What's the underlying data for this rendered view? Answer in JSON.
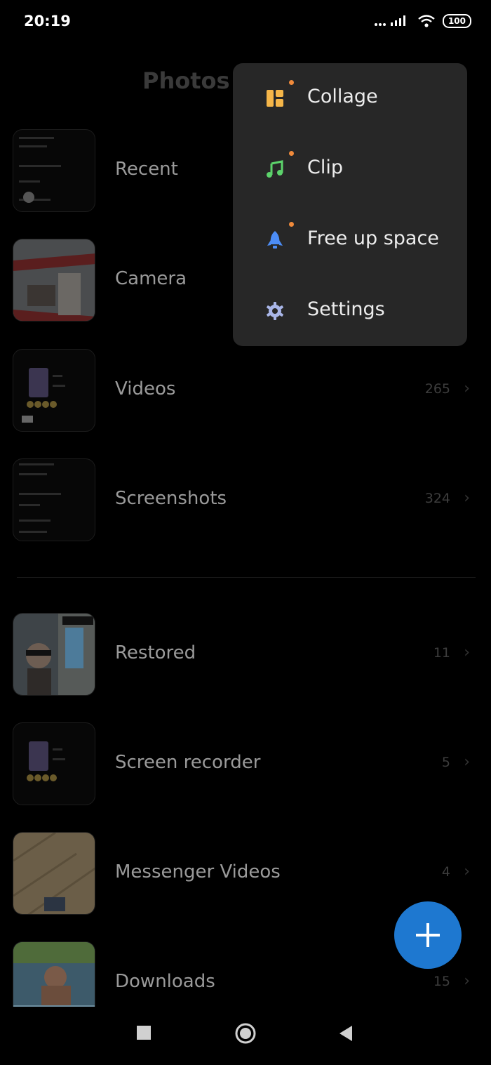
{
  "status": {
    "time": "20:19",
    "battery": "100"
  },
  "header": {
    "title": "Photos"
  },
  "albums": [
    {
      "name": "Recent",
      "count": ""
    },
    {
      "name": "Camera",
      "count": ""
    },
    {
      "name": "Videos",
      "count": "265"
    },
    {
      "name": "Screenshots",
      "count": "324"
    },
    {
      "name": "Restored",
      "count": "11"
    },
    {
      "name": "Screen recorder",
      "count": "5"
    },
    {
      "name": "Messenger Videos",
      "count": "4"
    },
    {
      "name": "Downloads",
      "count": "15"
    }
  ],
  "menu": {
    "items": [
      {
        "label": "Collage",
        "icon": "collage-icon",
        "color": "#f5b649",
        "badge": true
      },
      {
        "label": "Clip",
        "icon": "music-note-icon",
        "color": "#5cd36b",
        "badge": true
      },
      {
        "label": "Free up space",
        "icon": "rocket-icon",
        "color": "#4c8df6",
        "badge": true
      },
      {
        "label": "Settings",
        "icon": "gear-icon",
        "color": "#a9b6e8",
        "badge": false
      }
    ]
  },
  "fab": {
    "icon": "plus-icon",
    "color": "#1e78d0"
  },
  "navbar": {
    "icons": [
      "square-recents-icon",
      "circle-home-icon",
      "triangle-back-icon"
    ]
  }
}
